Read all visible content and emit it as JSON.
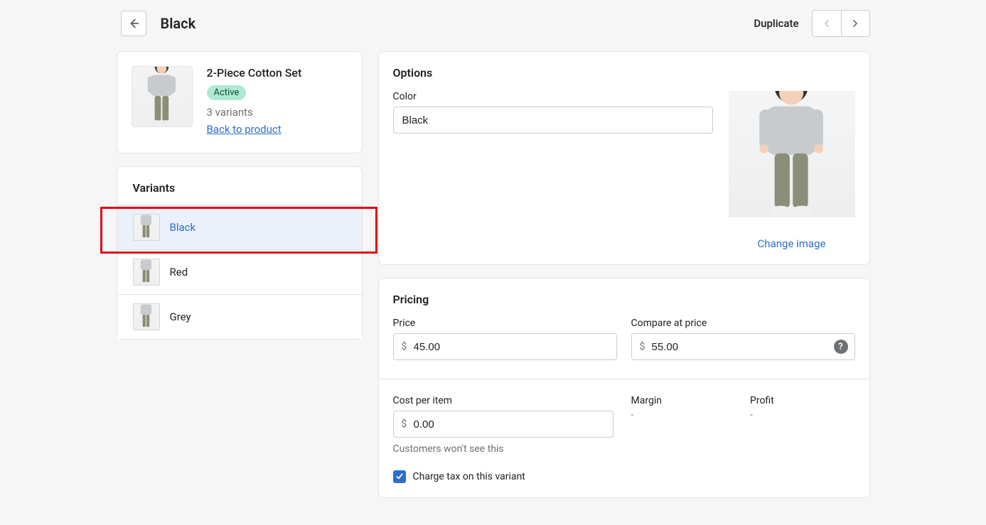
{
  "header": {
    "title": "Black",
    "duplicate_label": "Duplicate"
  },
  "product": {
    "title": "2-Piece Cotton Set",
    "status_badge": "Active",
    "variant_count": "3 variants",
    "back_link": "Back to product"
  },
  "variants": {
    "heading": "Variants",
    "items": [
      {
        "label": "Black",
        "selected": true
      },
      {
        "label": "Red",
        "selected": false
      },
      {
        "label": "Grey",
        "selected": false
      }
    ]
  },
  "options": {
    "heading": "Options",
    "color_label": "Color",
    "color_value": "Black",
    "change_image": "Change image"
  },
  "pricing": {
    "heading": "Pricing",
    "price_label": "Price",
    "price_value": "45.00",
    "compare_label": "Compare at price",
    "compare_value": "55.00",
    "cost_label": "Cost per item",
    "cost_value": "0.00",
    "cost_helper": "Customers won't see this",
    "margin_label": "Margin",
    "margin_value": "-",
    "profit_label": "Profit",
    "profit_value": "-",
    "currency": "$",
    "tax_label": "Charge tax on this variant",
    "tax_checked": true
  }
}
